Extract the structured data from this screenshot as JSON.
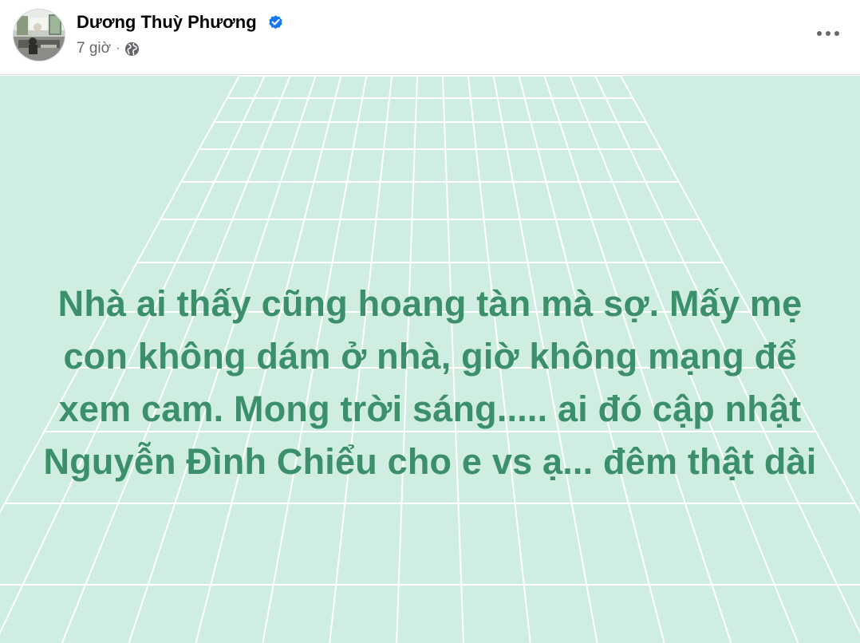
{
  "post": {
    "author": {
      "name": "Dương Thuỳ Phương",
      "verified": true,
      "avatar_icon": "profile-photo-icon"
    },
    "meta": {
      "time": "7 giờ",
      "separator": "·",
      "audience_icon": "globe-icon"
    },
    "more_icon": "more-options-icon",
    "body": {
      "background_color": "#d0ede1",
      "grid_color": "#ffffff",
      "text_color": "#3b8f6a",
      "lines": [
        "Nhà ai thấy cũng hoang tàn mà sợ. Mấy mẹ",
        "con không dám ở nhà, giờ không mạng để",
        "xem cam. Mong trời sáng..... ai đó cập nhật",
        "Nguyễn Đình Chiểu cho e vs ạ... đêm thật dài"
      ]
    }
  },
  "colors": {
    "name_text": "#050505",
    "meta_text": "#65676b",
    "verified_blue": "#1877f2"
  }
}
